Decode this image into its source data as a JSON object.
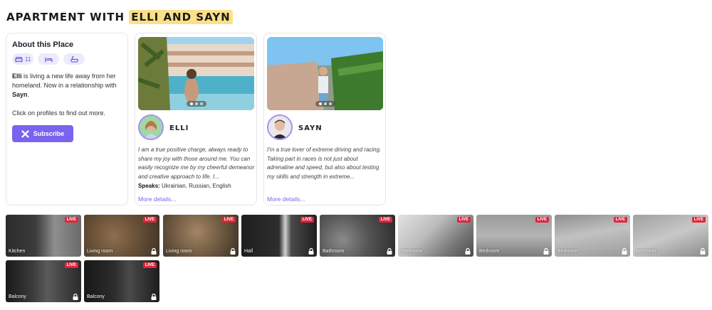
{
  "header": {
    "title_prefix": "APARTMENT WITH",
    "title_highlight": "ELLI AND SAYN"
  },
  "about": {
    "heading": "About this Place",
    "chips": [
      {
        "icon": "couch-icon",
        "count": "11"
      },
      {
        "icon": "bed-icon",
        "count": ""
      },
      {
        "icon": "bathtub-icon",
        "count": ""
      }
    ],
    "p1_name": "Elli",
    "p1_text1": " is living a new life away from her homeland. Now in a relationship with ",
    "p1_partner": "Sayn",
    "p1_end": ".",
    "p2": "Click on profiles to find out more.",
    "subscribe_label": "Subscribe"
  },
  "profiles": [
    {
      "name": "ELLI",
      "bio": "I am a true positive charge, always ready to share my joy with those around me. You can easily recognize me by my cheerful demeanor and creative approach to life. I...",
      "speaks_label": "Speaks:",
      "speaks": " Ukrainian, Russian, English",
      "more": "More details..."
    },
    {
      "name": "SAYN",
      "bio": "I'm a true lover of extreme driving and racing. Taking part in races is not just about adrenaline and speed, but also about testing my skills and strength in extreme...",
      "speaks_label": "",
      "speaks": "",
      "more": "More details..."
    }
  ],
  "live_badge": "LIVE",
  "cameras": [
    {
      "label": "Kitchen",
      "locked": false
    },
    {
      "label": "Living room",
      "locked": true
    },
    {
      "label": "Living room",
      "locked": true
    },
    {
      "label": "Hall",
      "locked": true
    },
    {
      "label": "Bathroom",
      "locked": true
    },
    {
      "label": "Bathroom",
      "locked": true
    },
    {
      "label": "Bedroom",
      "locked": true
    },
    {
      "label": "Bedroom",
      "locked": true
    },
    {
      "label": "Bedroom",
      "locked": true
    },
    {
      "label": "Balcony",
      "locked": true
    },
    {
      "label": "Balcony",
      "locked": true
    }
  ],
  "colors": {
    "accent": "#7b63f0",
    "highlight": "#fbe08a",
    "live": "#e2243b"
  }
}
